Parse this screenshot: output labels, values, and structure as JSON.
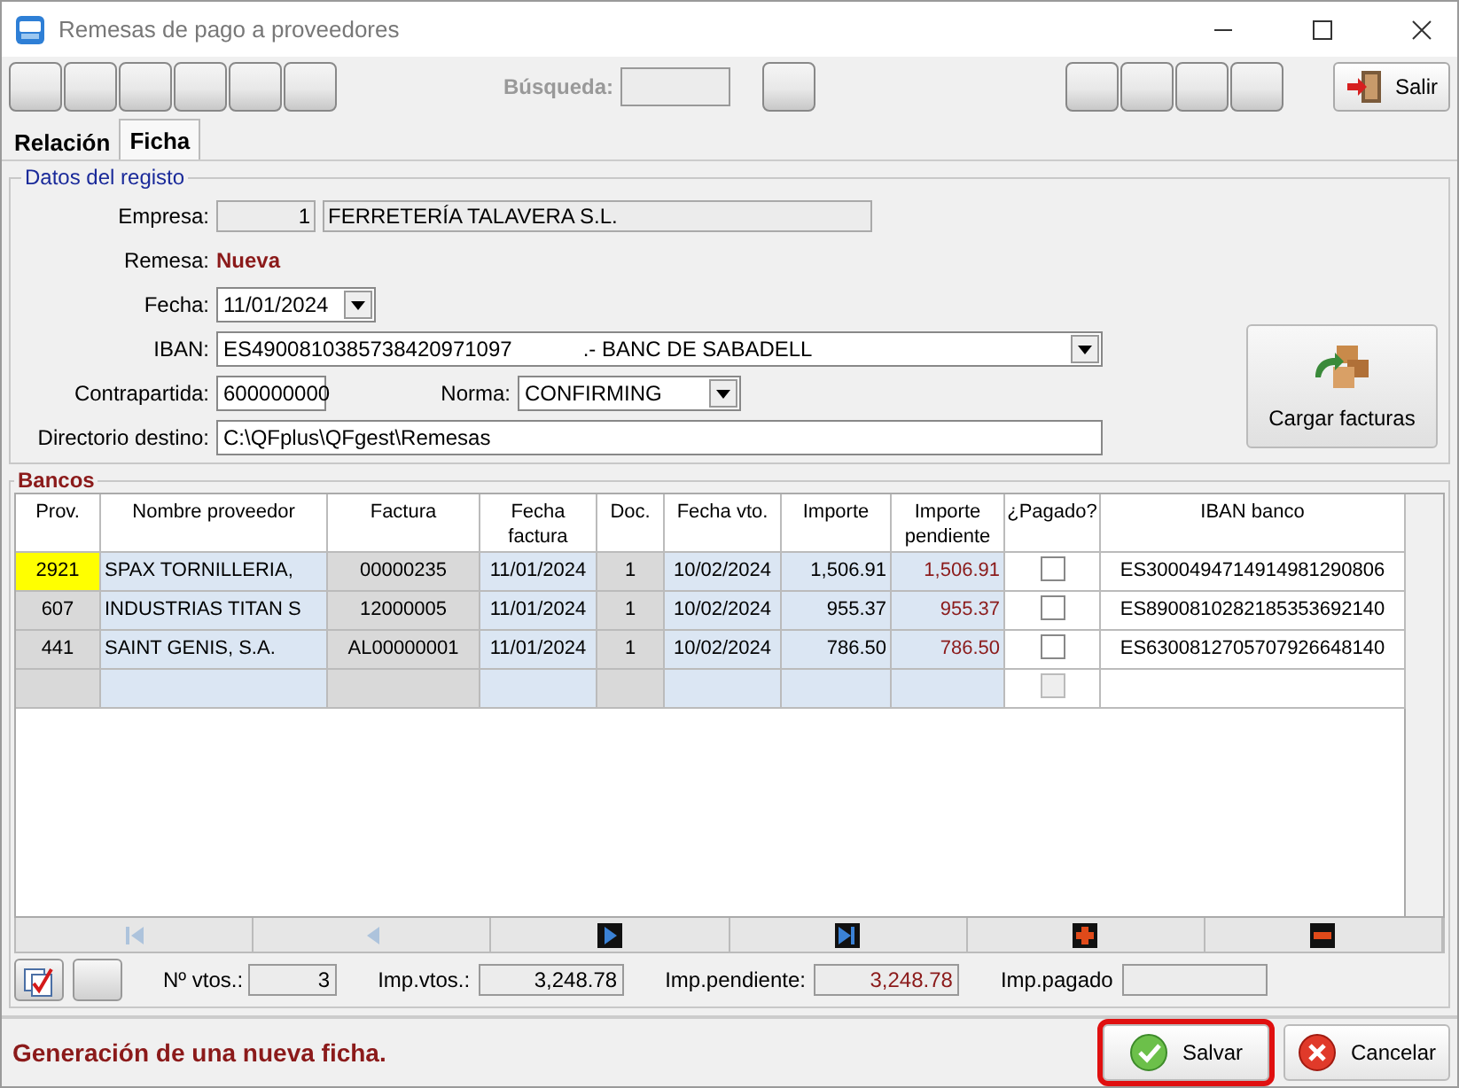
{
  "window": {
    "title": "Remesas de pago a proveedores"
  },
  "toolbar": {
    "search_label": "Búsqueda:",
    "exit_button": "Salir"
  },
  "tabs": [
    {
      "label": "Relación",
      "selected": false
    },
    {
      "label": "Ficha",
      "selected": true
    }
  ],
  "registro": {
    "title": "Datos del registo",
    "empresa": {
      "label": "Empresa:",
      "code": "1",
      "name": "FERRETERÍA TALAVERA S.L."
    },
    "remesa": {
      "label": "Remesa:",
      "value": "Nueva"
    },
    "fecha": {
      "label": "Fecha:",
      "value": "11/01/2024"
    },
    "iban": {
      "label": "IBAN:",
      "value": "ES4900810385738420971097            .- BANC DE SABADELL"
    },
    "contrapartida": {
      "label": "Contrapartida:",
      "value": "600000000"
    },
    "norma": {
      "label": "Norma:",
      "value": "CONFIRMING"
    },
    "directorio": {
      "label": "Directorio destino:",
      "value": "C:\\QFplus\\QFgest\\Remesas"
    },
    "load_button": "Cargar facturas"
  },
  "bancos": {
    "title": "Bancos",
    "columns": [
      {
        "label": "Prov.",
        "kind": "key"
      },
      {
        "label": "Nombre proveedor",
        "kind": "text"
      },
      {
        "label": "Factura",
        "kind": "code"
      },
      {
        "label": "Fecha factura",
        "kind": "date"
      },
      {
        "label": "Doc.",
        "kind": "code"
      },
      {
        "label": "Fecha vto.",
        "kind": "date"
      },
      {
        "label": "Importe",
        "kind": "amount"
      },
      {
        "label": "Importe pendiente",
        "kind": "pending"
      },
      {
        "label": "¿Pagado?",
        "kind": "check"
      },
      {
        "label": "IBAN banco",
        "kind": "iban"
      }
    ],
    "rows": [
      {
        "selected": true,
        "paid": false,
        "cells": [
          "2921",
          "SPAX TORNILLERIA,",
          "00000235",
          "11/01/2024",
          "1",
          "10/02/2024",
          "1,506.91",
          "1,506.91",
          "",
          "ES3000494714914981290806"
        ]
      },
      {
        "selected": false,
        "paid": false,
        "cells": [
          "607",
          "INDUSTRIAS TITAN S",
          "12000005",
          "11/01/2024",
          "1",
          "10/02/2024",
          "955.37",
          "955.37",
          "",
          "ES8900810282185353692140"
        ]
      },
      {
        "selected": false,
        "paid": false,
        "cells": [
          "441",
          "SAINT GENIS, S.A.",
          "AL00000001",
          "11/01/2024",
          "1",
          "10/02/2024",
          "786.50",
          "786.50",
          "",
          "ES6300812705707926648140"
        ]
      }
    ],
    "new_row": {
      "disabled": true
    },
    "nav": [
      {
        "kind": "first",
        "disabled": true
      },
      {
        "kind": "prev",
        "disabled": true
      },
      {
        "kind": "next",
        "disabled": false
      },
      {
        "kind": "last",
        "disabled": false
      },
      {
        "kind": "add",
        "disabled": false
      },
      {
        "kind": "remove",
        "disabled": false
      }
    ],
    "totals": [
      {
        "label": "Nº vtos.:",
        "value": "3",
        "kind": "count"
      },
      {
        "label": "Imp.vtos.:",
        "value": "3,248.78",
        "kind": "amount"
      },
      {
        "label": "Imp.pendiente:",
        "value": "3,248.78",
        "kind": "pending"
      },
      {
        "label": "Imp.pagado",
        "kind": "amount"
      }
    ]
  },
  "status": {
    "message": "Generación de una nueva ficha."
  },
  "buttons": [
    {
      "label": "Salvar",
      "kind": "save",
      "focused": true
    },
    {
      "label": "Cancelar",
      "kind": "cancel",
      "focused": false
    }
  ]
}
